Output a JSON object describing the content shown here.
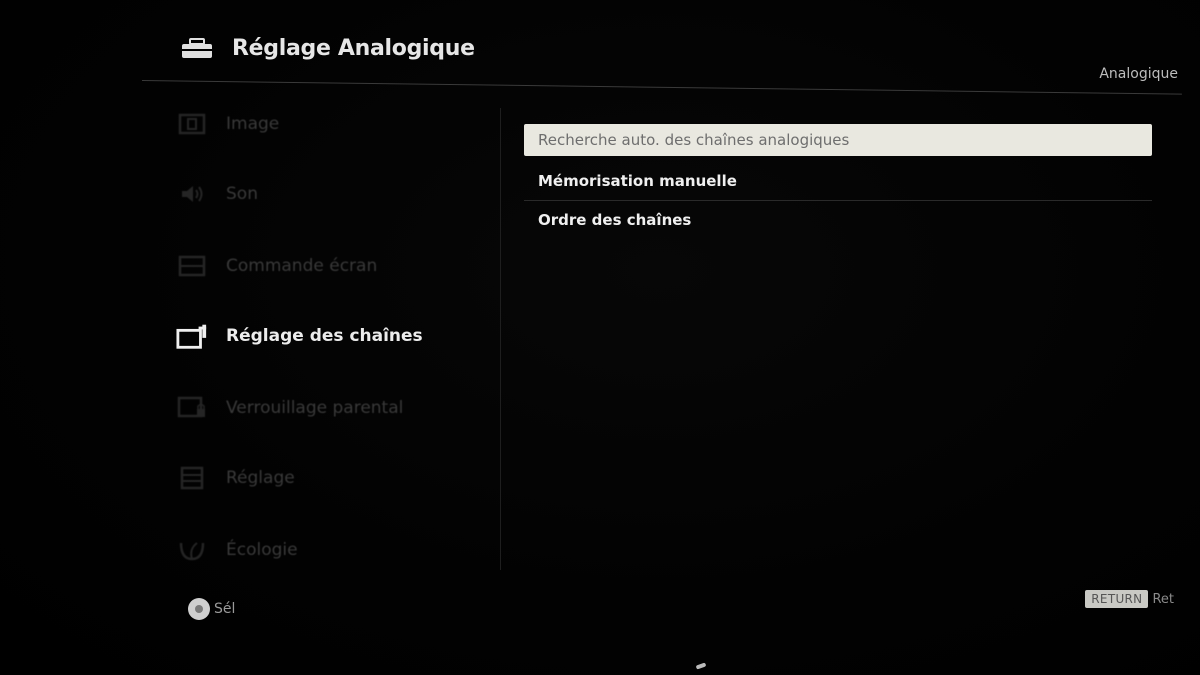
{
  "header": {
    "title": "Réglage Analogique",
    "icon": "toolbox-icon",
    "mode": "Analogique"
  },
  "sidebar": {
    "items": [
      {
        "label": "Image",
        "icon": "picture-icon",
        "active": false
      },
      {
        "label": "Son",
        "icon": "speaker-icon",
        "active": false
      },
      {
        "label": "Commande écran",
        "icon": "screen-control-icon",
        "active": false
      },
      {
        "label": "Réglage des chaînes",
        "icon": "channel-setup-icon",
        "active": true
      },
      {
        "label": "Verrouillage parental",
        "icon": "parental-lock-icon",
        "active": false
      },
      {
        "label": "Réglage",
        "icon": "settings-list-icon",
        "active": false
      },
      {
        "label": "Écologie",
        "icon": "eco-leaf-icon",
        "active": false
      }
    ]
  },
  "panel": {
    "options": [
      {
        "label": "Recherche auto. des chaînes analogiques",
        "selected": true
      },
      {
        "label": "Mémorisation manuelle",
        "selected": false
      },
      {
        "label": "Ordre des chaînes",
        "selected": false
      }
    ]
  },
  "footer": {
    "select_label": "Sél",
    "return_key": "RETURN",
    "return_label": "Ret"
  },
  "colors": {
    "background": "#000000",
    "selected_bg": "#e9e8e0",
    "active_text": "#ececec",
    "dim_text": "#3a3a3a"
  }
}
